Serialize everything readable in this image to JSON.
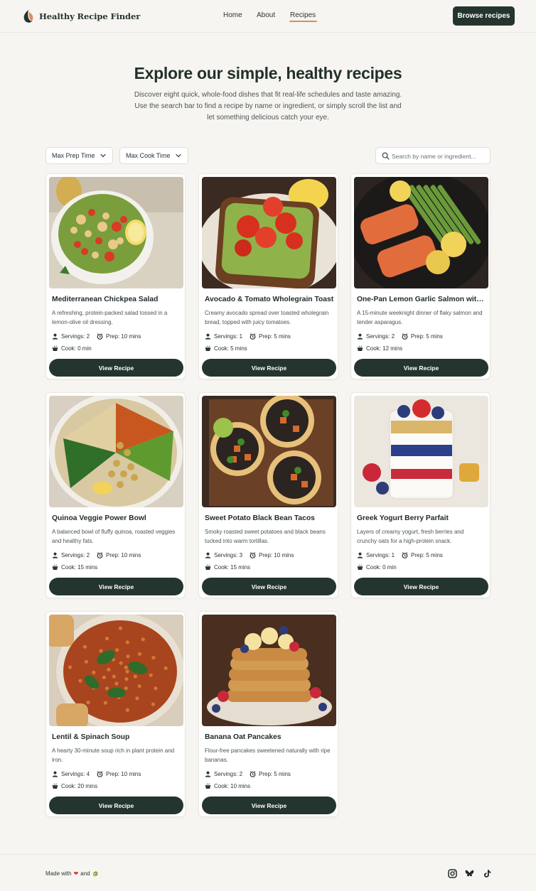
{
  "header": {
    "logo_text": "Healthy Recipe Finder",
    "nav": {
      "home": "Home",
      "about": "About",
      "recipes": "Recipes",
      "active": "Recipes"
    },
    "cta": "Browse recipes"
  },
  "hero": {
    "title": "Explore our simple, healthy recipes",
    "subtitle": "Discover eight quick, whole-food dishes that fit real-life schedules and taste amazing. Use the search bar to find a recipe by name or ingredient, or simply scroll the list and let something delicious catch your eye."
  },
  "filters": {
    "prep": "Max Prep Time",
    "cook": "Max Cook Time",
    "search_placeholder": "Search by name or ingredient...",
    "search_value": ""
  },
  "button_label": "View Recipe",
  "recipes": [
    {
      "title": "Mediterranean Chickpea Salad",
      "desc": "A refreshing, protein-packed salad tossed in a lemon-olive oil dressing.",
      "servings": "Servings: 2",
      "prep": "Prep: 10 mins",
      "cook": "Cook: 0 min"
    },
    {
      "title": "Avocado & Tomato Wholegrain Toast",
      "desc": "Creamy avocado spread over toasted wholegrain bread, topped with juicy tomatoes.",
      "servings": "Servings: 1",
      "prep": "Prep: 5 mins",
      "cook": "Cook: 5 mins"
    },
    {
      "title": "One-Pan Lemon Garlic Salmon with...",
      "desc": "A 15-minute weeknight dinner of flaky salmon and tender asparagus.",
      "servings": "Servings: 2",
      "prep": "Prep: 5 mins",
      "cook": "Cook: 12 mins"
    },
    {
      "title": "Quinoa Veggie Power Bowl",
      "desc": "A balanced bowl of fluffy quinoa, roasted veggies and healthy fats.",
      "servings": "Servings: 2",
      "prep": "Prep: 10 mins",
      "cook": "Cook: 15 mins"
    },
    {
      "title": "Sweet Potato Black Bean Tacos",
      "desc": "Smoky roasted sweet potatoes and black beans tucked into warm tortillas.",
      "servings": "Servings: 3",
      "prep": "Prep: 10 mins",
      "cook": "Cook: 15 mins"
    },
    {
      "title": "Greek Yogurt Berry Parfait",
      "desc": "Layers of creamy yogurt, fresh berries and crunchy oats for a high-protein snack.",
      "servings": "Servings: 1",
      "prep": "Prep: 5 mins",
      "cook": "Cook: 0 min"
    },
    {
      "title": "Lentil & Spinach Soup",
      "desc": "A hearty 30-minute soup rich in plant protein and iron.",
      "servings": "Servings: 4",
      "prep": "Prep: 10 mins",
      "cook": "Cook: 20 mins"
    },
    {
      "title": "Banana Oat Pancakes",
      "desc": "Flour-free pancakes sweetened naturally with ripe bananas.",
      "servings": "Servings: 2",
      "prep": "Prep: 5 mins",
      "cook": "Cook: 10 mins"
    }
  ],
  "footer": {
    "made_with": "Made with",
    "and": "and",
    "socials": [
      "instagram-icon",
      "bluesky-icon",
      "tiktok-icon"
    ]
  },
  "colors": {
    "primary": "#24352f",
    "accent": "#e08a5c",
    "background": "#f7f5f1"
  }
}
